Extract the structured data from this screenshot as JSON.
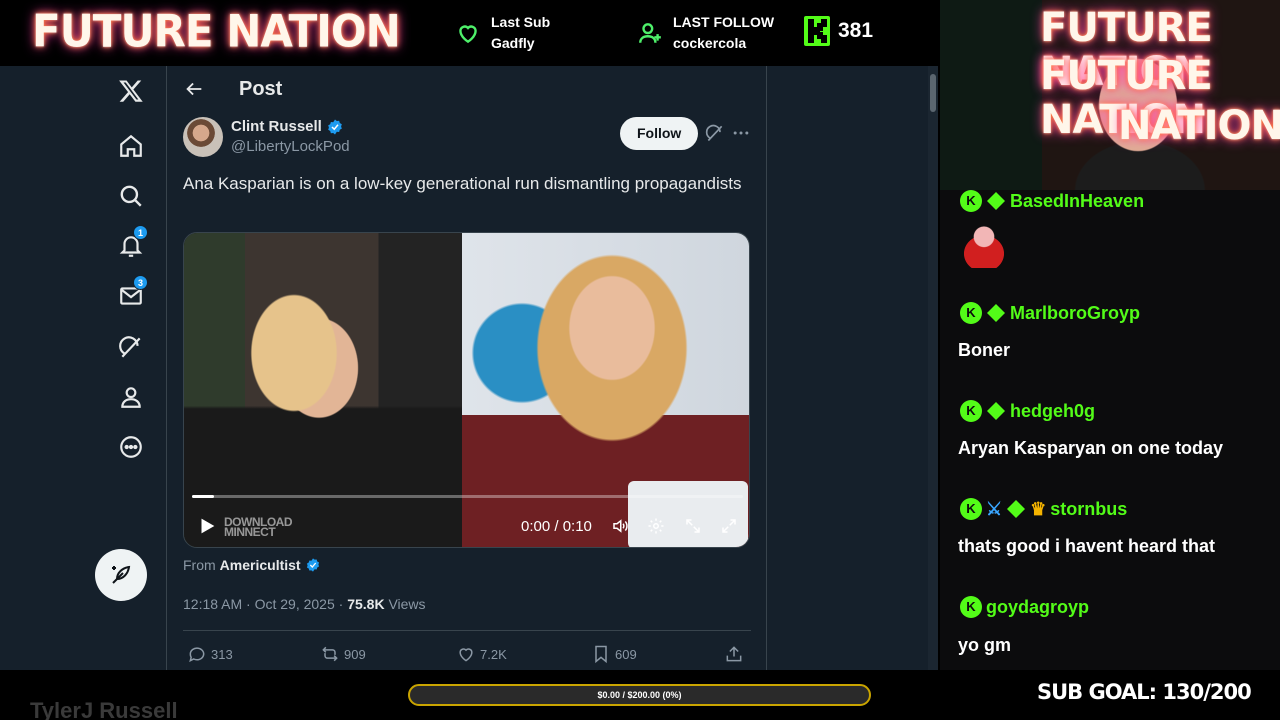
{
  "overlay": {
    "brand": "FUTURE NATION",
    "last_sub_label": "Last Sub",
    "last_sub_name": "Gadfly",
    "last_follow_label": "LAST FOLLOW",
    "last_follow_name": "cockercola",
    "follower_count": "381",
    "webcam_sign_1": "FUTURE NATION",
    "webcam_sign_2": "FUTURE NATION",
    "webcam_sign_3": "NATION",
    "streamer_name": "TylerJ Russell",
    "goal_text": "$0.00 / $200.00 (0%)",
    "goal_progress": 0,
    "sub_goal": "SUB GOAL: 130/200",
    "accent": "#53fc18"
  },
  "x_nav": {
    "items": [
      {
        "name": "x-logo",
        "badge": ""
      },
      {
        "name": "home",
        "badge": ""
      },
      {
        "name": "explore",
        "badge": ""
      },
      {
        "name": "notifications",
        "badge": "1"
      },
      {
        "name": "messages",
        "badge": "3"
      },
      {
        "name": "grok",
        "badge": ""
      },
      {
        "name": "profile",
        "badge": ""
      },
      {
        "name": "more",
        "badge": ""
      }
    ]
  },
  "post": {
    "header_title": "Post",
    "author_name": "Clint Russell",
    "author_handle": "@LibertyLockPod",
    "follow_label": "Follow",
    "text": "Ana Kasparian is on a low-key generational run dismantling propagandists",
    "video": {
      "time": "0:00 / 0:10",
      "watermark_line1": "DOWNLOAD",
      "watermark_line2": "MINNECT",
      "progress": 0.04
    },
    "from_label": "From",
    "from_name": "Americultist",
    "time_date": "12:18 AM · Oct 29, 2025 · ",
    "views_count": "75.8K",
    "views_label": " Views",
    "replies": "313",
    "reposts": "909",
    "likes": "7.2K",
    "bookmarks": "609"
  },
  "chat": [
    {
      "user": "BasedInHeaven",
      "text": "",
      "has_emote": true
    },
    {
      "user": "MarlboroGroyp",
      "text": "Boner"
    },
    {
      "user": "hedgeh0g",
      "text": "Aryan Kasparyan on one today"
    },
    {
      "user": "stornbus",
      "text": "thats good i havent heard that"
    },
    {
      "user": "goydagroyp",
      "text": "yo gm"
    }
  ]
}
